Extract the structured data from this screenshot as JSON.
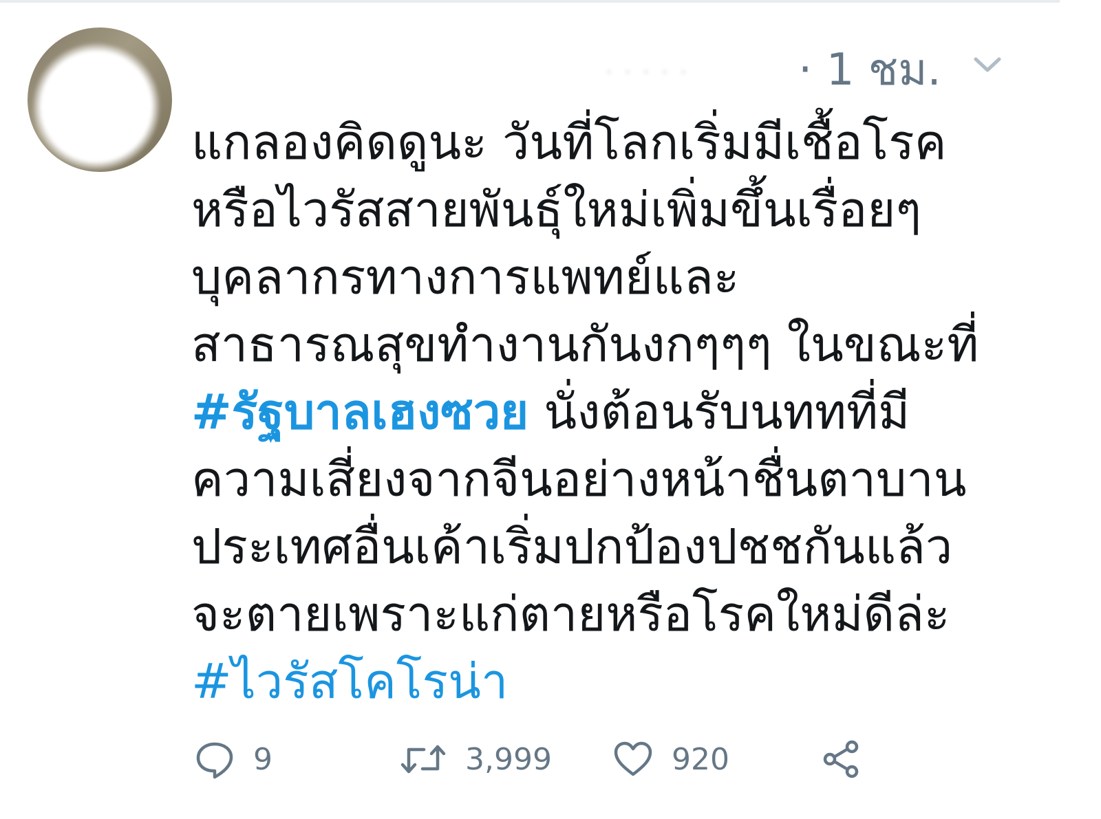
{
  "tweet": {
    "author_blurred": "· · · · ·",
    "timestamp": "· 1 ชม.",
    "lines": [
      {
        "text": "แกลองคิดดูนะ วันที่โลกเริ่มมีเชื้อโรค"
      },
      {
        "text": "หรือไวรัสสายพันธุ์ใหม่เพิ่มขึ้นเรื่อยๆ"
      },
      {
        "text": "บุคลากรทางการแพทย์และ"
      },
      {
        "text": "สาธารณสุขทำงานกันงกๆๆๆ ในขณะที่"
      },
      {
        "hashtag": "#รัฐบาลเฮงซวย",
        "text": " นั่งต้อนรับนททที่มี"
      },
      {
        "text": "ความเสี่ยงจากจีนอย่างหน้าชื่นตาบาน"
      },
      {
        "text": "ประเทศอื่นเค้าเริ่มปกป้องปชชกันแล้ว"
      },
      {
        "text": "จะตายเพราะแก่ตายหรือโรคใหม่ดีล่ะ"
      },
      {
        "hashtag": "#ไวรัสโคโรน่า"
      }
    ]
  },
  "actions": {
    "reply_count": "9",
    "retweet_count": "3,999",
    "like_count": "920"
  },
  "icons": {
    "reply": "reply-icon",
    "retweet": "retweet-icon",
    "like": "heart-icon",
    "share": "share-icon",
    "menu": "chevron-down-icon"
  },
  "colors": {
    "text": "#14171a",
    "muted": "#657786",
    "hashtag": "#1b95e0"
  }
}
